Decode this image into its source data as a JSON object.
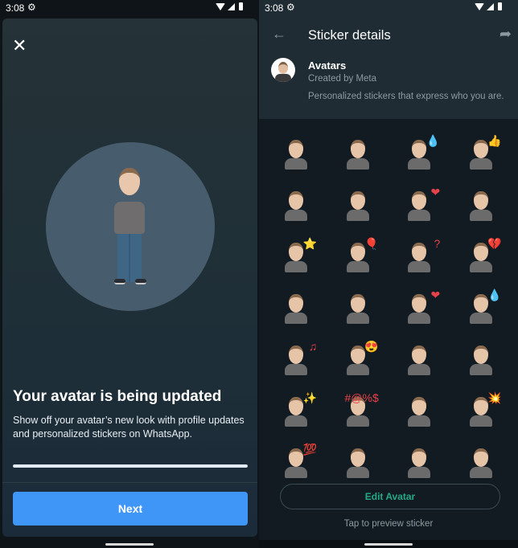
{
  "left": {
    "status": {
      "time": "3:08"
    },
    "close_icon": "✕",
    "title": "Your avatar is being updated",
    "description": "Show off your avatar’s new look with profile updates and personalized stickers on WhatsApp.",
    "progress": 1.0,
    "next_label": "Next",
    "colors": {
      "accent": "#4096f7",
      "progress": "#e2ebf1"
    }
  },
  "right": {
    "status": {
      "time": "3:08"
    },
    "header": {
      "title": "Sticker details",
      "back_icon": "←",
      "share_icon": "➦"
    },
    "pack": {
      "name": "Avatars",
      "creator": "Created by Meta",
      "description": "Personalized stickers that express who you are."
    },
    "stickers": [
      {
        "name": "arms-raised",
        "emoji": ""
      },
      {
        "name": "neutral",
        "emoji": ""
      },
      {
        "name": "crying",
        "emoji": "💧"
      },
      {
        "name": "thumbs-up",
        "emoji": "👍"
      },
      {
        "name": "snap-fingers",
        "emoji": ""
      },
      {
        "name": "skeptical",
        "emoji": ""
      },
      {
        "name": "hearts-around",
        "emoji": "❤"
      },
      {
        "name": "hands-together",
        "emoji": ""
      },
      {
        "name": "birthday-cake",
        "emoji": "⭐"
      },
      {
        "name": "balloon",
        "emoji": "🎈"
      },
      {
        "name": "question-marks",
        "emoji": "?"
      },
      {
        "name": "broken-heart",
        "emoji": "💔"
      },
      {
        "name": "thinking",
        "emoji": ""
      },
      {
        "name": "wink",
        "emoji": ""
      },
      {
        "name": "blow-kiss",
        "emoji": "❤"
      },
      {
        "name": "laughing-tears",
        "emoji": "💧"
      },
      {
        "name": "dancing-music",
        "emoji": "♫"
      },
      {
        "name": "heart-eyes",
        "emoji": "😍"
      },
      {
        "name": "facepalm",
        "emoji": ""
      },
      {
        "name": "worried",
        "emoji": ""
      },
      {
        "name": "sparkles-meditate",
        "emoji": "✨"
      },
      {
        "name": "censored-curse",
        "emoji": "#@%$"
      },
      {
        "name": "shrug-wave",
        "emoji": ""
      },
      {
        "name": "mind-blown",
        "emoji": "💥"
      },
      {
        "name": "hundred",
        "emoji": "💯"
      },
      {
        "name": "pointing",
        "emoji": ""
      },
      {
        "name": "desk-work",
        "emoji": ""
      },
      {
        "name": "peek",
        "emoji": ""
      }
    ],
    "edit_label": "Edit Avatar",
    "hint": "Tap to preview sticker",
    "colors": {
      "accent": "#25a887"
    }
  }
}
